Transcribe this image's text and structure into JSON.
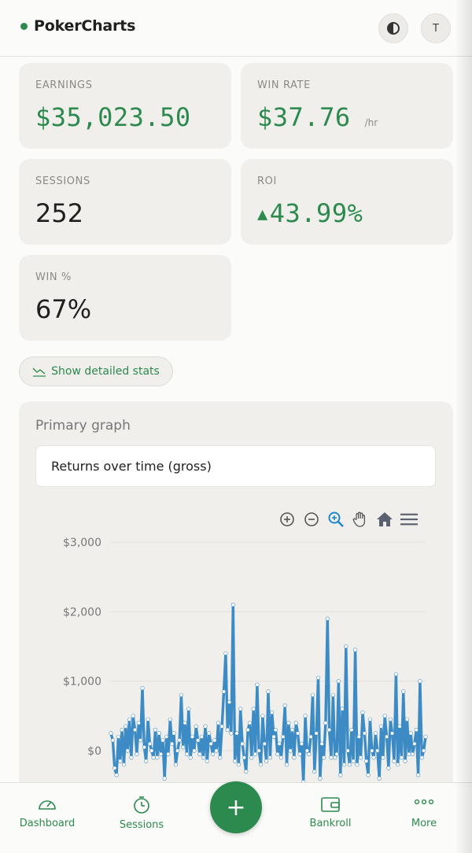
{
  "app": {
    "title": "PokerCharts",
    "avatar_initial": "T"
  },
  "colors": {
    "accent": "#2c8a4e",
    "series": "#3d8bc4"
  },
  "stats": {
    "earnings": {
      "label": "EARNINGS",
      "value": "$35,023.50"
    },
    "win_rate": {
      "label": "WIN RATE",
      "value": "$37.76",
      "unit": "/hr"
    },
    "sessions": {
      "label": "SESSIONS",
      "value": "252"
    },
    "roi": {
      "label": "ROI",
      "value": "43.99%",
      "direction": "up"
    },
    "win_pct": {
      "label": "WIN %",
      "value": "67%"
    }
  },
  "detail_button": {
    "label": "Show detailed stats"
  },
  "graph": {
    "title": "Primary graph",
    "selected": "Returns over time (gross)"
  },
  "chart_data": {
    "type": "line",
    "title": "",
    "xlabel": "",
    "ylabel": "",
    "ylim": [
      -500,
      3000
    ],
    "yticks": [
      "$3,000",
      "$2,000",
      "$1,000",
      "$0"
    ],
    "ytick_values": [
      3000,
      2000,
      1000,
      0
    ],
    "grid": true,
    "series": [
      {
        "values": [
          250,
          150,
          -250,
          -350,
          200,
          -150,
          300,
          -200,
          350,
          0,
          450,
          -100,
          500,
          300,
          -50,
          400,
          150,
          900,
          50,
          -150,
          450,
          100,
          0,
          -100,
          300,
          -100,
          250,
          -50,
          150,
          -400,
          200,
          -50,
          450,
          100,
          250,
          -200,
          0,
          150,
          800,
          50,
          400,
          -50,
          600,
          -100,
          200,
          0,
          350,
          150,
          -50,
          200,
          -100,
          350,
          -150,
          250,
          100,
          -50,
          150,
          0,
          400,
          -100,
          350,
          850,
          1400,
          300,
          700,
          250,
          2100,
          -150,
          250,
          -200,
          600,
          100,
          -100,
          -300,
          300,
          400,
          -100,
          600,
          -50,
          950,
          0,
          -200,
          500,
          100,
          -150,
          850,
          -100,
          550,
          200,
          300,
          -50,
          100,
          -100,
          200,
          650,
          -200,
          400,
          0,
          300,
          -100,
          400,
          250,
          -50,
          100,
          -450,
          500,
          0,
          -50,
          200,
          800,
          -300,
          250,
          1050,
          -400,
          100,
          -100,
          400,
          1900,
          300,
          -100,
          800,
          -100,
          -50,
          1000,
          -350,
          600,
          -200,
          1500,
          0,
          -200,
          300,
          -150,
          1450,
          -200,
          200,
          -100,
          550,
          250,
          -150,
          -350,
          450,
          0,
          -100,
          250,
          0,
          -400,
          350,
          -100,
          500,
          200,
          -250,
          450,
          250,
          -150,
          1100,
          -200,
          350,
          -100,
          850,
          -150,
          450,
          -50,
          250,
          -50,
          100,
          300,
          -350,
          1000,
          -100,
          0,
          200
        ]
      }
    ]
  },
  "nav": {
    "dashboard": "Dashboard",
    "sessions": "Sessions",
    "add": "+",
    "bankroll": "Bankroll",
    "more": "More"
  }
}
